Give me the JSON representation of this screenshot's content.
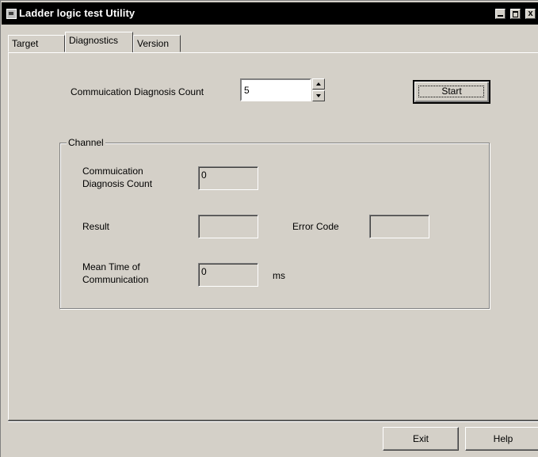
{
  "window": {
    "title": "Ladder logic test Utility",
    "close_glyph": "x"
  },
  "tabs": [
    {
      "label": "Target"
    },
    {
      "label": "Diagnostics",
      "active": true
    },
    {
      "label": "Version"
    }
  ],
  "diagnostics": {
    "count_label": "Commuication Diagnosis Count",
    "count_value": "5",
    "start_label": "Start"
  },
  "channel": {
    "group_label": "Channel",
    "count_label_line1": "Commuication",
    "count_label_line2": "Diagnosis Count",
    "count_value": "0",
    "result_label": "Result",
    "result_value": "",
    "error_label": "Error Code",
    "error_value": "",
    "mean_label_line1": "Mean Time of",
    "mean_label_line2": "Communication",
    "mean_value": "0",
    "mean_unit": "ms"
  },
  "footer": {
    "exit_label": "Exit",
    "help_label": "Help"
  }
}
